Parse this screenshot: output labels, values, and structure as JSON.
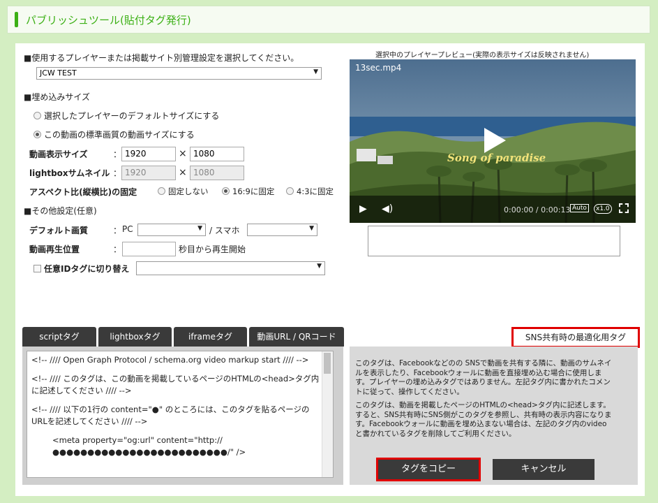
{
  "header": {
    "title": "パブリッシュツール(貼付タグ発行)"
  },
  "settings": {
    "player_select_heading": "■使用するプレイヤーまたは掲載サイト別管理設定を選択してください。",
    "player_select_value": "JCW TEST",
    "embed_size_heading": "■埋め込みサイズ",
    "option_default_size": "選択したプレイヤーのデフォルトサイズにする",
    "option_standard_size": "この動画の標準画質の動画サイズにする",
    "video_size_label": "動画表示サイズ",
    "colon": "：",
    "video_width": "1920",
    "video_height": "1080",
    "lightbox_label": "lightboxサムネイル",
    "lightbox_width": "1920",
    "lightbox_height": "1080",
    "times": "×",
    "aspect_label": "アスペクト比(縦横比)の固定",
    "aspect_options": [
      "固定しない",
      "16:9に固定",
      "4:3に固定"
    ],
    "other_heading": "■その他設定(任意)",
    "default_quality_label": "デフォルト画質",
    "pc_label": "PC",
    "smartphone_label": "/ スマホ",
    "start_position_label": "動画再生位置",
    "start_position_suffix": "秒目から再生開始",
    "custom_id_label": "任意IDタグに切り替え"
  },
  "preview": {
    "caption": "選択中のプレイヤープレビュー(実際の表示サイズは反映されません)",
    "filename": "13sec.mp4",
    "overlay_text": "Song of paradise",
    "time": "0:00:00 / 0:00:13",
    "auto": "Auto",
    "speed": "x1.0"
  },
  "tabs": [
    "scriptタグ",
    "lightboxタグ",
    "iframeタグ",
    "動画URL / QRコード"
  ],
  "sns_tab": "SNS共有時の最適化用タグ",
  "code_lines": [
    "<!-- //// Open Graph Protocol / schema.org video markup start //// -->",
    "<!-- //// このタグは、この動画を掲載しているページのHTMLの<head>タグ内に記述してください //// -->",
    "<!-- //// 以下の1行の content=\"●\" のところには、このタグを貼るページのURLを記述してください //// -->",
    "<meta property=\"og:url\" content=\"http://●●●●●●●●●●●●●●●●●●●●●●●●●/\" />"
  ],
  "description": {
    "p1": "このタグは、Facebookなどのの SNSで動画を共有する隣に、動画のサムネイルを表示したり、Facebookウォールに動画を直接埋め込む場合に使用します。プレイヤーの埋め込みタグではありません。左記タグ内に書かれたコメントに従って、操作してください。",
    "p2": "このタグは、動画を掲載したページのHTMLの<head>タグ内に記述します。すると、SNS共有時にSNS側がこのタグを参照し、共有時の表示内容になります。Facebookウォールに動画を埋め込まない場合は、左記のタグ内のvideoと書かれているタグを削除してご利用ください。"
  },
  "buttons": {
    "copy": "タグをコピー",
    "cancel": "キャンセル"
  }
}
